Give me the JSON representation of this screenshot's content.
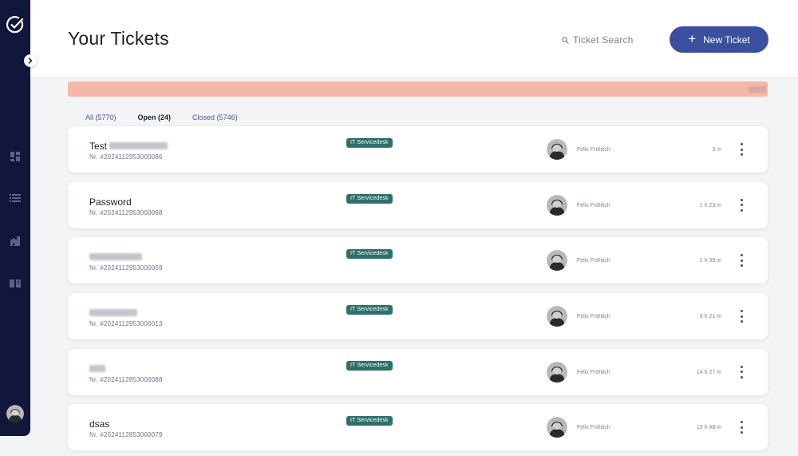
{
  "header": {
    "title": "Your Tickets",
    "search_placeholder": "Ticket Search",
    "new_ticket_label": "New Ticket"
  },
  "colors": {
    "sidebar": "#11173a",
    "accent": "#3a4f9e",
    "banner": "#f6b7aa",
    "badge": "#2e6f6a"
  },
  "sidebar": {
    "items": [
      {
        "icon": "dashboard-icon"
      },
      {
        "icon": "list-icon"
      },
      {
        "icon": "building-icon"
      },
      {
        "icon": "book-icon"
      }
    ]
  },
  "tabs": [
    {
      "label": "All (5770)",
      "active": false
    },
    {
      "label": "Open (24)",
      "active": true
    },
    {
      "label": "Closed (5746)",
      "active": false
    }
  ],
  "tickets": [
    {
      "title": "Test",
      "number": "Nr. #2024112953000086",
      "category": "IT Servicedesk",
      "assignee": "Felix Fröhlich",
      "time": "3 m"
    },
    {
      "title": "Password",
      "number": "Nr. #2024112953000068",
      "category": "IT Servicedesk",
      "assignee": "Felix Fröhlich",
      "time": "1 h 23 m"
    },
    {
      "title": "",
      "number": "Nr. #2024112953000059",
      "category": "IT Servicedesk",
      "assignee": "Felix Fröhlich",
      "time": "1 h 39 m"
    },
    {
      "title": "",
      "number": "Nr. #2024112953000013",
      "category": "IT Servicedesk",
      "assignee": "Felix Fröhlich",
      "time": "9 h 21 m"
    },
    {
      "title": "",
      "number": "Nr. #2024112853000088",
      "category": "IT Servicedesk",
      "assignee": "Felix Fröhlich",
      "time": "14 h 27 m"
    },
    {
      "title": "dsas",
      "number": "Nr. #2024112853000079",
      "category": "IT Servicedesk",
      "assignee": "Felix Fröhlich",
      "time": "15 h 48 m"
    }
  ]
}
